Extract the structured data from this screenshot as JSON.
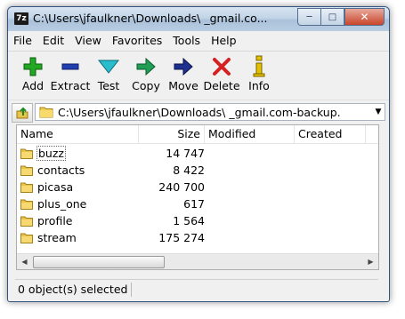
{
  "window": {
    "app_icon_text": "7z",
    "title": "C:\\Users\\jfaulkner\\Downloads\\                     _gmail.co..."
  },
  "menu": [
    "File",
    "Edit",
    "View",
    "Favorites",
    "Tools",
    "Help"
  ],
  "toolbar": [
    {
      "label": "Add",
      "icon": "plus-icon",
      "color": "#1e9a1e"
    },
    {
      "label": "Extract",
      "icon": "minus-icon",
      "color": "#1f3ea8"
    },
    {
      "label": "Test",
      "icon": "check-icon",
      "color": "#1aa6b7"
    },
    {
      "label": "Copy",
      "icon": "copy-arrow-icon",
      "color": "#1a8f4a"
    },
    {
      "label": "Move",
      "icon": "move-arrow-icon",
      "color": "#1f2f8a"
    },
    {
      "label": "Delete",
      "icon": "delete-x-icon",
      "color": "#d42222"
    },
    {
      "label": "Info",
      "icon": "info-icon",
      "color": "#d8b400"
    }
  ],
  "address": {
    "path": "C:\\Users\\jfaulkner\\Downloads\\               _gmail.com-backup."
  },
  "columns": [
    "Name",
    "Size",
    "Modified",
    "Created"
  ],
  "rows": [
    {
      "name": "buzz",
      "size": "14 747",
      "selected": true
    },
    {
      "name": "contacts",
      "size": "8 422",
      "selected": false
    },
    {
      "name": "picasa",
      "size": "240 700",
      "selected": false
    },
    {
      "name": "plus_one",
      "size": "617",
      "selected": false
    },
    {
      "name": "profile",
      "size": "1 564",
      "selected": false
    },
    {
      "name": "stream",
      "size": "175 274",
      "selected": false
    }
  ],
  "status": {
    "text": "0 object(s) selected"
  }
}
